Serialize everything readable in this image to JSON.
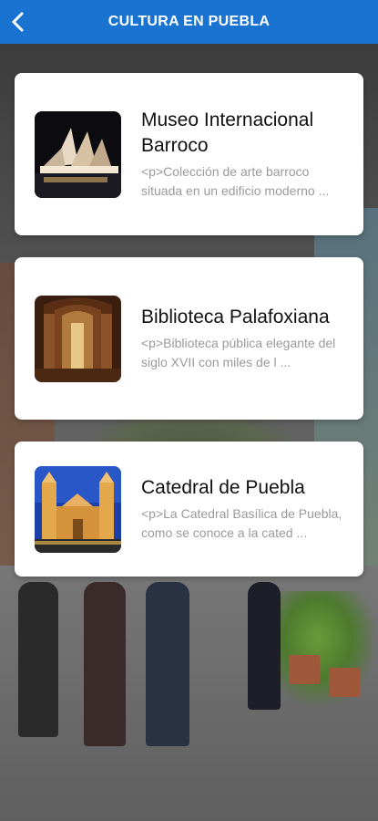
{
  "header": {
    "title": "CULTURA EN PUEBLA",
    "back_icon": "chevron-left-icon",
    "color": "#1a73d1"
  },
  "cards": [
    {
      "title": "Museo Internacional Barroco",
      "description": "<p>Colección de arte barroco situada en un edificio moderno ..."
    },
    {
      "title": "Biblioteca Palafoxiana",
      "description": "<p>Biblioteca pública elegante del siglo XVII con miles de l ..."
    },
    {
      "title": "Catedral de Puebla",
      "description": "<p>La Catedral Basílica de Puebla, como se conoce a la cated ..."
    }
  ]
}
